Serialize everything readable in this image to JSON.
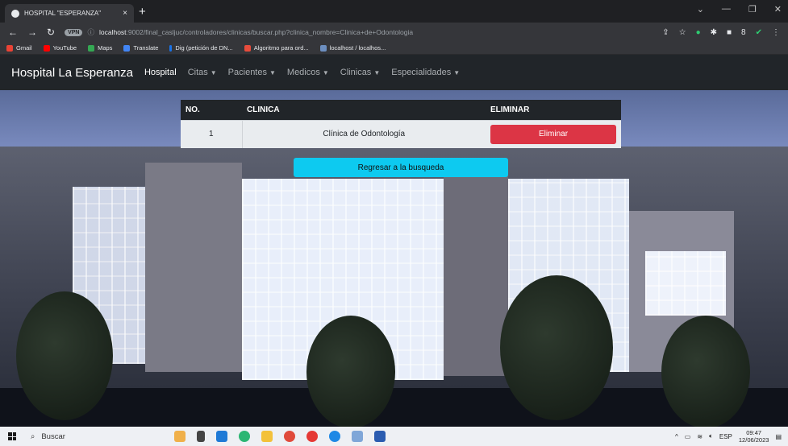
{
  "browser": {
    "tab_title": "HOSPITAL \"ESPERANZA\"",
    "tab_close": "×",
    "new_tab": "+",
    "vpn_badge": "VPN",
    "url_host": "localhost",
    "url_path": ":9002/final_casljuc/controladores/clinicas/buscar.php?clinica_nombre=Clinica+de+Odontologia",
    "bookmarks": [
      "Gmail",
      "YouTube",
      "Maps",
      "Translate",
      "Dig (petición de DN...",
      "Algoritmo para ord...",
      "localhost / localhos..."
    ]
  },
  "navbar": {
    "brand": "Hospital La Esperanza",
    "links": [
      "Hospital",
      "Citas",
      "Pacientes",
      "Medicos",
      "Clinicas",
      "Especialidades"
    ]
  },
  "table": {
    "headers": [
      "NO.",
      "CLINICA",
      "ELIMINAR"
    ],
    "rows": [
      {
        "no": "1",
        "clinica": "Clínica de Odontología",
        "action": "Eliminar"
      }
    ]
  },
  "back_button": "Regresar a la busqueda",
  "taskbar": {
    "search_label": "Buscar",
    "lang": "ESP",
    "time": "09:47",
    "date": "12/06/2023"
  },
  "colors": {
    "navbar_bg": "#212529",
    "danger": "#dc3545",
    "info": "#0dcaf0"
  }
}
